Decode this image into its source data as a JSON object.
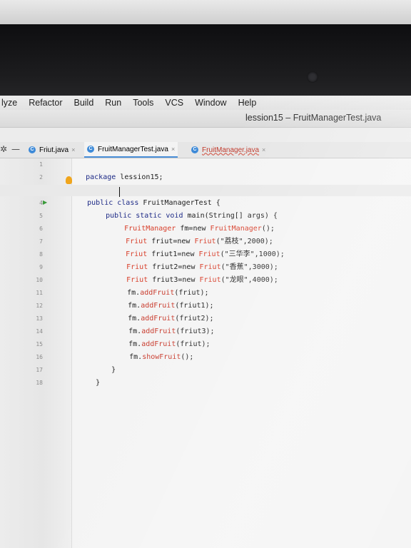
{
  "menu": [
    "lyze",
    "Refactor",
    "Build",
    "Run",
    "Tools",
    "VCS",
    "Window",
    "Help"
  ],
  "window_title": "lession15 – FruitManagerTest.java",
  "tabs": [
    {
      "label": "Friut.java",
      "icon": "java-class-icon",
      "close": "×"
    },
    {
      "label": "FruitManagerTest.java",
      "icon": "java-class-icon",
      "close": "×"
    },
    {
      "label": "FruitManager.java",
      "icon": "java-class-icon",
      "close": "×"
    }
  ],
  "line_numbers": [
    "1",
    "2",
    "3",
    "4",
    "5",
    "6",
    "7",
    "8",
    "9",
    "10",
    "11",
    "12",
    "13",
    "14",
    "15",
    "16",
    "17",
    "18"
  ],
  "code": {
    "l1_kw": "package ",
    "l1_pkg": "lession15;",
    "l3_kw": "public class ",
    "l3_name": "FruitManagerTest {",
    "l4_kw": "public static void ",
    "l4_rest": "main(String[] args) {",
    "l5_type": "FruitManager",
    "l5_mid": " fm=new ",
    "l5_ctor": "FruitManager",
    "l5_end": "();",
    "l6_type": "Friut",
    "l6_mid": " friut=new ",
    "l6_ctor": "Friut",
    "l6_args": "(\"荔枝\",2000);",
    "l7_type": "Friut",
    "l7_mid": " friut1=new ",
    "l7_ctor": "Friut",
    "l7_args": "(\"三华李\",1000);",
    "l8_type": "Friut",
    "l8_mid": " friut2=new ",
    "l8_ctor": "Friut",
    "l8_args": "(\"香蕉\",3000);",
    "l9_type": "Friut",
    "l9_mid": " friut3=new ",
    "l9_ctor": "Friut",
    "l9_args": "(\"龙眼\",4000);",
    "l10_obj": "fm.",
    "l10_fn": "addFruit",
    "l10_args": "(friut);",
    "l11_obj": "fm.",
    "l11_fn": "addFruit",
    "l11_args": "(friut1);",
    "l12_obj": "fm.",
    "l12_fn": "addFruit",
    "l12_args": "(friut2);",
    "l13_obj": "fm.",
    "l13_fn": "addFruit",
    "l13_args": "(friut3);",
    "l14_obj": "fm.",
    "l14_fn": "addFruit",
    "l14_args": "(friut);",
    "l15_obj": "fm.",
    "l15_fn": "showFruit",
    "l15_args": "();",
    "l16": "}",
    "l17": "}"
  },
  "colors": {
    "keyword": "#1d2a86",
    "type": "#d8402c",
    "method": "#c93c2e",
    "active_tab": "#4a90d9"
  }
}
